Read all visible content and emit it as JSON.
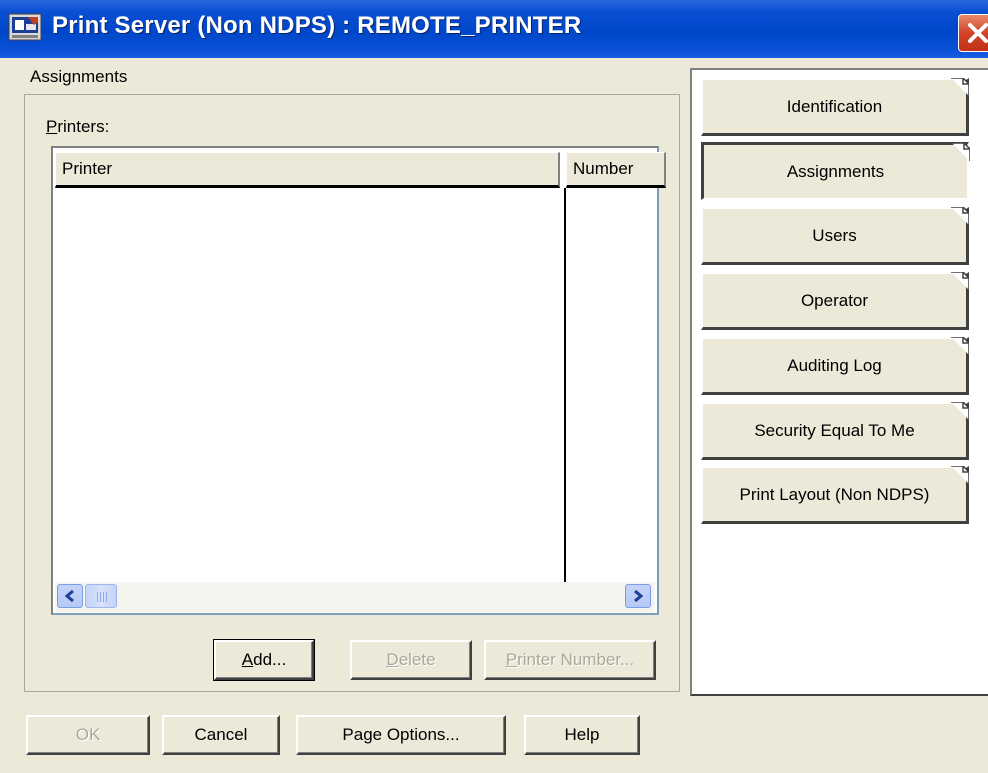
{
  "window": {
    "title": "Print Server (Non NDPS) : REMOTE_PRINTER"
  },
  "icons": {
    "app": "printer-server-icon",
    "close": "close-icon",
    "scroll_left": "chevron-left-icon",
    "scroll_right": "chevron-right-icon",
    "page_fold": "page-corner-fold-icon"
  },
  "colors": {
    "titlebar": "#0046c8",
    "face": "#ece9d8",
    "close_button": "#d2442a"
  },
  "assignments": {
    "group_label": "Assignments",
    "printers_label_underlined": "P",
    "printers_label_rest": "rinters:",
    "columns": [
      "Printer",
      "Number"
    ],
    "rows": []
  },
  "list_buttons": {
    "add_underlined": "A",
    "add_rest": "dd...",
    "delete_underlined": "D",
    "delete_rest": "elete",
    "printer_number_underlined": "P",
    "printer_number_rest": "rinter Number..."
  },
  "footer_buttons": {
    "ok": "OK",
    "cancel": "Cancel",
    "page_options": "Page Options...",
    "help": "Help"
  },
  "tabs": [
    {
      "label": "Identification"
    },
    {
      "label": "Assignments"
    },
    {
      "label": "Users"
    },
    {
      "label": "Operator"
    },
    {
      "label": "Auditing Log"
    },
    {
      "label": "Security Equal To Me"
    },
    {
      "label": "Print Layout (Non NDPS)"
    }
  ],
  "selected_tab": "Assignments"
}
